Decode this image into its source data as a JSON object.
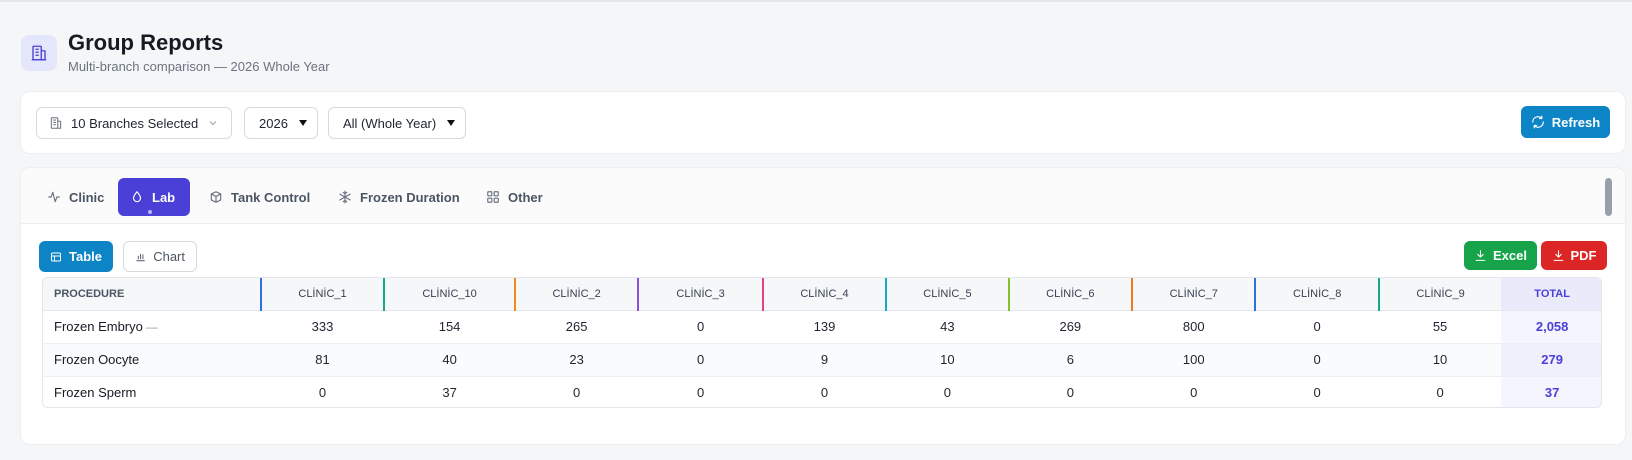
{
  "header": {
    "icon": "building-icon",
    "title": "Group Reports",
    "subtitle": "Multi-branch comparison — 2026 Whole Year"
  },
  "filters": {
    "branches_label": "10 Branches Selected",
    "year_value": "2026",
    "period_value": "All (Whole Year)",
    "refresh_label": "Refresh"
  },
  "tabs": [
    {
      "label": "Clinic",
      "icon": "activity-icon",
      "active": false
    },
    {
      "label": "Lab",
      "icon": "droplet-icon",
      "active": true
    },
    {
      "label": "Tank Control",
      "icon": "box-icon",
      "active": false
    },
    {
      "label": "Frozen Duration",
      "icon": "snowflake-icon",
      "active": false
    },
    {
      "label": "Other",
      "icon": "grid-icon",
      "active": false
    }
  ],
  "view": {
    "table_label": "Table",
    "chart_label": "Chart",
    "excel_label": "Excel",
    "pdf_label": "PDF"
  },
  "table": {
    "procedure_header": "PROCEDURE",
    "total_header": "TOTAL",
    "clinics": [
      {
        "name": "CLİNİC_1",
        "color": "#2f6fe4"
      },
      {
        "name": "CLİNİC_10",
        "color": "#16a88a"
      },
      {
        "name": "CLİNİC_2",
        "color": "#f08a1c"
      },
      {
        "name": "CLİNİC_3",
        "color": "#8b4fd8"
      },
      {
        "name": "CLİNİC_4",
        "color": "#e83e8c"
      },
      {
        "name": "CLİNİC_5",
        "color": "#17a9c7"
      },
      {
        "name": "CLİNİC_6",
        "color": "#84c225"
      },
      {
        "name": "CLİNİC_7",
        "color": "#f07a22"
      },
      {
        "name": "CLİNİC_8",
        "color": "#2f6fe4"
      },
      {
        "name": "CLİNİC_9",
        "color": "#16a88a"
      }
    ],
    "rows": [
      {
        "procedure": "Frozen Embryo",
        "suffix": "—",
        "values": [
          "333",
          "154",
          "265",
          "0",
          "139",
          "43",
          "269",
          "800",
          "0",
          "55"
        ],
        "total": "2,058"
      },
      {
        "procedure": "Frozen Oocyte",
        "suffix": "",
        "values": [
          "81",
          "40",
          "23",
          "0",
          "9",
          "10",
          "6",
          "100",
          "0",
          "10"
        ],
        "total": "279"
      },
      {
        "procedure": "Frozen Sperm",
        "suffix": "",
        "values": [
          "0",
          "37",
          "0",
          "0",
          "0",
          "0",
          "0",
          "0",
          "0",
          "0"
        ],
        "total": "37"
      }
    ]
  },
  "colors": {
    "accent_primary": "#0d84c6",
    "tab_active": "#4a3fd6",
    "excel": "#17a34a",
    "pdf": "#dc2626"
  }
}
